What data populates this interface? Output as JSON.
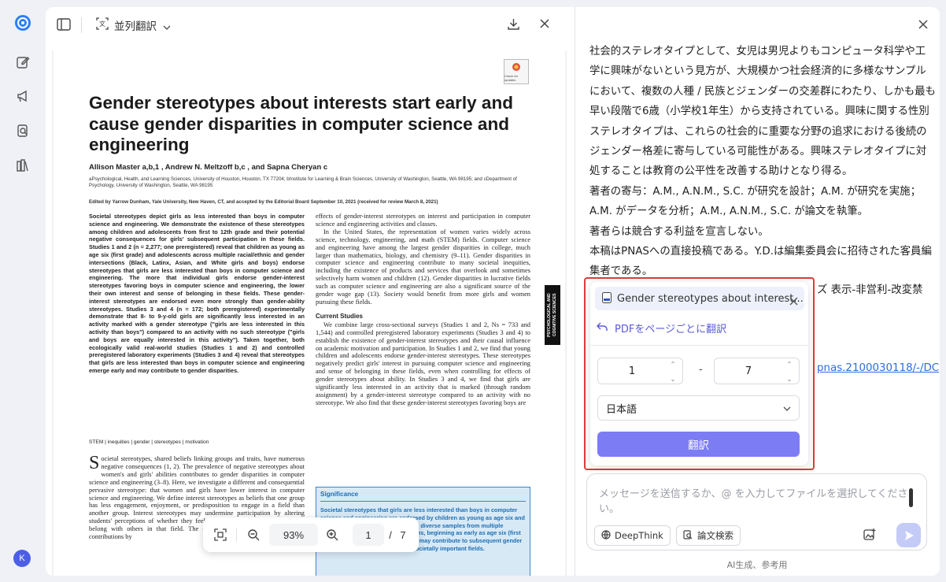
{
  "toolbar": {
    "mode_label": "並列翻訳"
  },
  "sidebar": {
    "avatar_initial": "K"
  },
  "paper": {
    "title": "Gender stereotypes about interests start early and cause gender disparities in computer science and engineering",
    "authors": "Allison Master a,b,1 , Andrew N. Meltzoff b,c , and Sapna Cheryan c",
    "affiliations": "aPsychological, Health, and Learning Sciences, University of Houston, Houston, TX 77204; bInstitute for Learning & Brain Sciences, University of Washington, Seattle, WA 98195; and cDepartment of Psychology, University of Washington, Seattle, WA 98195",
    "edited_by": "Edited by Yarrow Dunham, Yale University, New Haven, CT, and accepted by the Editorial Board September 10, 2021 (received for review March 8, 2021)",
    "abstract": "Societal stereotypes depict girls as less interested than boys in computer science and engineering. We demonstrate the existence of these stereotypes among children and adolescents from first to 12th grade and their potential negative consequences for girls' subsequent participation in these fields. Studies 1 and 2 (n = 2,277; one preregistered) reveal that children as young as age six (first grade) and adolescents across multiple racial/ethnic and gender intersections (Black, Latinx, Asian, and White girls and boys) endorse stereotypes that girls are less interested than boys in computer science and engineering. The more that individual girls endorse gender-interest stereotypes favoring boys in computer science and engineering, the lower their own interest and sense of belonging in these fields. These gender-interest stereotypes are endorsed even more strongly than gender-ability stereotypes. Studies 3 and 4 (n = 172; both preregistered) experimentally demonstrate that 8- to 9-y-old girls are significantly less interested in an activity marked with a gender stereotype (\"girls are less interested in this activity than boys\") compared to an activity with no such stereotype (\"girls and boys are equally interested in this activity\"). Taken together, both ecologically valid real-world studies (Studies 1 and 2) and controlled preregistered laboratory experiments (Studies 3 and 4) reveal that stereotypes that girls are less interested than boys in computer science and engineering emerge early and may contribute to gender disparities.",
    "keywords": "STEM | inequities | gender | stereotypes | motivation",
    "dropcap": "S",
    "body_left": "ocietal stereotypes, shared beliefs linking groups and traits, have numerous negative consequences (1, 2). The prevalence of negative stereotypes about women's and girls' abilities contributes to gender disparities in computer science and engineering (3–8). Here, we investigate a different and consequential pervasive stereotype: that women and girls have lower interest in computer science and engineering. We define interest stereotypes as beliefs that one group has less engagement, enjoyment, or predisposition to engage in a field than another group. Interest stereotypes may undermine participation by altering students' perceptions of whether they feel their sense of whether they would belong with others in that field. The current studies make three primary contributions by",
    "body_right_1": "effects of gender-interest stereotypes on interest and participation in computer science and engineering activities and classes.",
    "body_right_2": "In the United States, the representation of women varies widely across science, technology, engineering, and math (STEM) fields. Computer science and engineering have among the largest gender disparities in college, much larger than mathematics, biology, and chemistry (9–11). Gender disparities in computer science and engineering contribute to many societal inequities, including the existence of products and services that overlook and sometimes selectively harm women and children (12). Gender disparities in lucrative fields such as computer science and engineering are also a significant source of the gender wage gap (13). Society would benefit from more girls and women pursuing these fields.",
    "section_heading": "Current Studies",
    "body_right_3": "We combine large cross-sectional surveys (Studies 1 and 2, Ns = 733 and 1,544) and controlled preregistered laboratory experiments (Studies 3 and 4) to establish the existence of gender-interest stereotypes and their causal influence on academic motivation and participation. In Studies 1 and 2, we find that young children and adolescents endorse gender-interest stereotypes. These stereotypes negatively predict girls' interest in pursuing computer science and engineering and sense of belonging in these fields, even when controlling for effects of gender stereotypes about ability. In Studies 3 and 4, we find that girls are significantly less interested in an activity that is marked (through random assignment) by a gender-interest stereotype compared to an activity with no stereotype. We also find that these gender-interest stereotypes favoring boys are",
    "significance_heading": "Significance",
    "significance_text": "Societal stereotypes that girls are less interested than boys in computer science and engineering are endorsed by children as young as age six and across large and socioeconomically diverse samples from multiple racial/ethnic and gender intersections, beginning as early as age six (first grade). Gender-interest stereotypes may contribute to subsequent gender disparities in the pursuit of these societally important fields.",
    "side_tab": "PSYCHOLOGICAL AND COGNITIVE SCIENCES",
    "badge": "Check for updates"
  },
  "zoom": {
    "level": "93%",
    "page": "1",
    "separator": "/",
    "total": "7"
  },
  "chat": {
    "paragraphs": [
      "社会的ステレオタイプとして、女児は男児よりもコンピュータ科学や工学に興味がないという見方が、大規模かつ社会経済的に多様なサンプルにおいて、複数の人種 / 民族とジェンダーの交差群にわたり、しかも最も早い段階で6歳（小学校1年生）から支持されている。興味に関する性別ステレオタイプは、これらの社会的に重要な分野の追求における後続のジェンダー格差に寄与している可能性がある。興味ステレオタイプに対処することは教育の公平性を改善する助けとなり得る。",
      "著者の寄与：A.M., A.N.M., S.C. が研究を設計；A.M. が研究を実施；A.M. がデータを分析；A.M., A.N.M., S.C. が論文を執筆。",
      "著者らは競合する利益を宣言しない。",
      "本稿はPNASへの直接投稿である。Y.D.は編集委員会に招待された客員編集者である。"
    ],
    "partial_line": "ズ 表示-非営利-改変禁",
    "partial_link": "pnas.2100030118/-/DC"
  },
  "popup": {
    "file_name": "Gender stereotypes about interest...",
    "translate_pages_label": "PDFをページごとに翻訳",
    "from_page": "1",
    "to_page": "7",
    "range_dash": "-",
    "language": "日本語",
    "translate_button": "翻訳"
  },
  "input": {
    "placeholder": "メッセージを送信するか、@ を入力してファイルを選択してください。",
    "deepthink_label": "DeepThink",
    "search_label": "論文検索"
  },
  "footer": {
    "note": "AI生成、参考用"
  },
  "colors": {
    "accent": "#7c7cf5",
    "link": "#2b6de0",
    "highlight_border": "#e03b3b",
    "significance_blue": "#1c6fb3"
  }
}
